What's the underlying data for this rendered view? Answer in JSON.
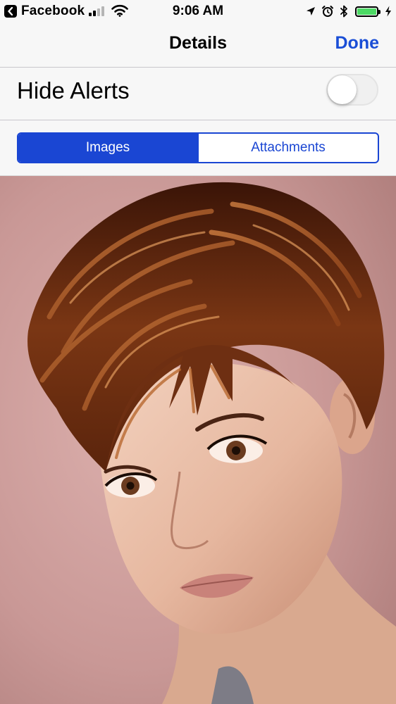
{
  "status_bar": {
    "back_app": "Facebook",
    "time": "9:06 AM",
    "battery_level": 1.0,
    "signal_bars": 2,
    "icons": [
      "back-chevron-icon",
      "signal-icon",
      "wifi-icon",
      "location-arrow-icon",
      "alarm-icon",
      "bluetooth-icon",
      "battery-icon",
      "charging-bolt-icon"
    ]
  },
  "nav": {
    "title": "Details",
    "done_label": "Done"
  },
  "alerts": {
    "label": "Hide Alerts",
    "enabled": false
  },
  "segments": {
    "items": [
      {
        "label": "Images",
        "selected": true
      },
      {
        "label": "Attachments",
        "selected": false
      }
    ]
  },
  "photo": {
    "subject": "portrait-photo"
  },
  "colors": {
    "accent": "#1a46d3",
    "background": "#f7f7f7",
    "battery": "#4cd964"
  }
}
